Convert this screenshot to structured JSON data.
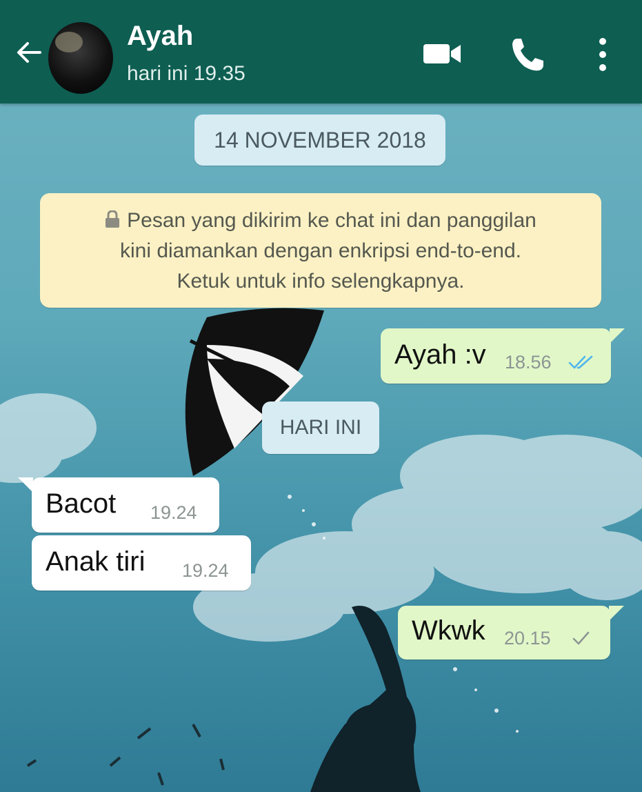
{
  "header": {
    "contact_name": "Ayah",
    "status": "hari ini 19.35",
    "icons": [
      "back-arrow-icon",
      "avatar",
      "video-call-icon",
      "phone-call-icon",
      "more-options-icon"
    ]
  },
  "chat": {
    "date_chip": "14 NOVEMBER 2018",
    "encryption_notice": {
      "line1": "Pesan yang dikirim ke chat ini dan panggilan",
      "line2": "kini diamankan dengan enkripsi end-to-end.",
      "line3": "Ketuk untuk info selengkapnya."
    },
    "today_chip": "HARI INI",
    "messages": [
      {
        "direction": "outgoing",
        "text": "Ayah :v",
        "time": "18.56",
        "status": "read"
      },
      {
        "direction": "incoming",
        "text": "Bacot",
        "time": "19.24"
      },
      {
        "direction": "incoming",
        "text": "Anak tiri",
        "time": "19.24"
      },
      {
        "direction": "outgoing",
        "text": "Wkwk",
        "time": "20.15",
        "status": "sent"
      }
    ]
  },
  "colors": {
    "header": "#0e5e52",
    "outgoing_bubble": "#e1f7c8",
    "incoming_bubble": "#ffffff",
    "read_tick": "#4fb6ec",
    "notice": "#fbf1c4"
  }
}
